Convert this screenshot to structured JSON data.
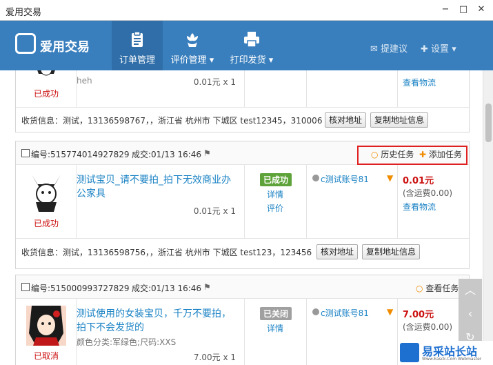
{
  "window": {
    "title": "爱用交易",
    "min": "−",
    "max": "□",
    "close": "✕"
  },
  "header": {
    "logo_text": "爱用交易",
    "nav": [
      {
        "label": "订单管理",
        "icon": "clipboard-icon"
      },
      {
        "label": "评价管理",
        "icon": "flower-icon"
      },
      {
        "label": "打印发货",
        "icon": "printer-icon"
      }
    ],
    "suggest": "提建议",
    "settings": "设置"
  },
  "order0": {
    "status": "已成功",
    "buyer_fragment": "heh",
    "price_qty": "0.01元 x 1",
    "logistics": "查看物流",
    "shipping": "收货信息：测试，13136598767，，浙江省 杭州市 下城区 test12345，310006",
    "btn_check": "核对地址",
    "btn_copy": "复制地址信息"
  },
  "order1": {
    "id": "编号:515774014927829",
    "deal": "成交:01/13 16:46",
    "history": "历史任务",
    "add_task": "添加任务",
    "title": "测试宝贝_请不要拍_拍下无效商业办公家具",
    "price_qty": "0.01元 x 1",
    "status_badge": "已成功",
    "detail": "详情",
    "review": "评价",
    "buyer": "c测试账号81",
    "price": "0.01元",
    "postage": "(含运费0.00)",
    "logistics": "查看物流",
    "avatar_status": "已成功",
    "shipping": "收货信息：测试，13136598756，，浙江省 杭州市 下城区 test123，123456",
    "btn_check": "核对地址",
    "btn_copy": "复制地址信息"
  },
  "order2": {
    "id": "编号:515000993727829",
    "deal": "成交:01/13 16:46",
    "view_task": "查看任务",
    "title": "测试使用的女装宝贝，千万不要拍，拍下不会发货的",
    "sku": "颜色分类:军绿色;尺码:XXS",
    "price_qty": "7.00元 x 1",
    "status_badge": "已关闭",
    "detail": "详情",
    "buyer": "c测试账号81",
    "price": "7.00元",
    "postage": "(含运费0.00)",
    "avatar_status": "已取消"
  },
  "watermark": {
    "text": "易采站长站",
    "sub": "Www.Easck.Com Webmaster"
  },
  "colors": {
    "header": "#3a7fbd",
    "link": "#1a82c4",
    "red": "#cc1111",
    "badge_success": "#5ea339",
    "badge_closed": "#a0a0a0",
    "orange": "#f08c00"
  }
}
